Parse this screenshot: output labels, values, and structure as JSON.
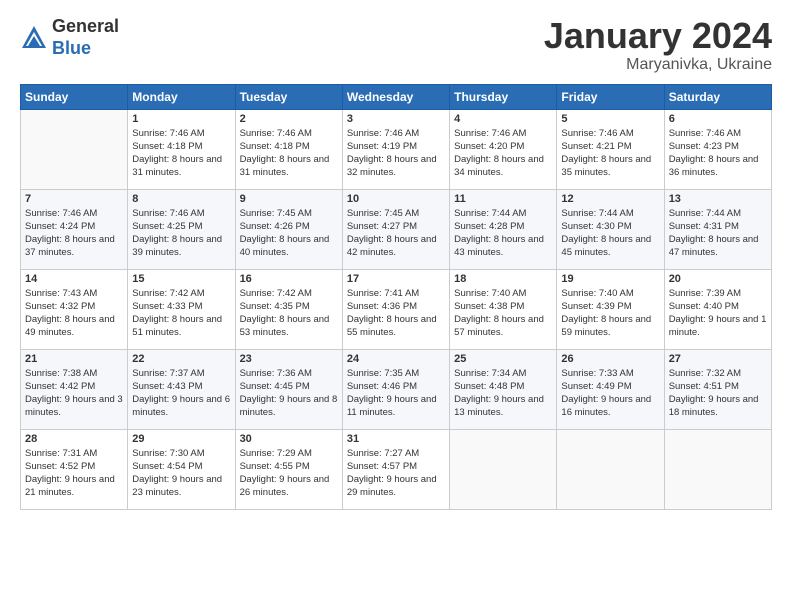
{
  "logo": {
    "general": "General",
    "blue": "Blue"
  },
  "header": {
    "month": "January 2024",
    "location": "Maryanivka, Ukraine"
  },
  "weekdays": [
    "Sunday",
    "Monday",
    "Tuesday",
    "Wednesday",
    "Thursday",
    "Friday",
    "Saturday"
  ],
  "weeks": [
    [
      {
        "day": "",
        "sunrise": "",
        "sunset": "",
        "daylight": ""
      },
      {
        "day": "1",
        "sunrise": "Sunrise: 7:46 AM",
        "sunset": "Sunset: 4:18 PM",
        "daylight": "Daylight: 8 hours and 31 minutes."
      },
      {
        "day": "2",
        "sunrise": "Sunrise: 7:46 AM",
        "sunset": "Sunset: 4:18 PM",
        "daylight": "Daylight: 8 hours and 31 minutes."
      },
      {
        "day": "3",
        "sunrise": "Sunrise: 7:46 AM",
        "sunset": "Sunset: 4:19 PM",
        "daylight": "Daylight: 8 hours and 32 minutes."
      },
      {
        "day": "4",
        "sunrise": "Sunrise: 7:46 AM",
        "sunset": "Sunset: 4:20 PM",
        "daylight": "Daylight: 8 hours and 34 minutes."
      },
      {
        "day": "5",
        "sunrise": "Sunrise: 7:46 AM",
        "sunset": "Sunset: 4:21 PM",
        "daylight": "Daylight: 8 hours and 35 minutes."
      },
      {
        "day": "6",
        "sunrise": "Sunrise: 7:46 AM",
        "sunset": "Sunset: 4:23 PM",
        "daylight": "Daylight: 8 hours and 36 minutes."
      }
    ],
    [
      {
        "day": "7",
        "sunrise": "Sunrise: 7:46 AM",
        "sunset": "Sunset: 4:24 PM",
        "daylight": "Daylight: 8 hours and 37 minutes."
      },
      {
        "day": "8",
        "sunrise": "Sunrise: 7:46 AM",
        "sunset": "Sunset: 4:25 PM",
        "daylight": "Daylight: 8 hours and 39 minutes."
      },
      {
        "day": "9",
        "sunrise": "Sunrise: 7:45 AM",
        "sunset": "Sunset: 4:26 PM",
        "daylight": "Daylight: 8 hours and 40 minutes."
      },
      {
        "day": "10",
        "sunrise": "Sunrise: 7:45 AM",
        "sunset": "Sunset: 4:27 PM",
        "daylight": "Daylight: 8 hours and 42 minutes."
      },
      {
        "day": "11",
        "sunrise": "Sunrise: 7:44 AM",
        "sunset": "Sunset: 4:28 PM",
        "daylight": "Daylight: 8 hours and 43 minutes."
      },
      {
        "day": "12",
        "sunrise": "Sunrise: 7:44 AM",
        "sunset": "Sunset: 4:30 PM",
        "daylight": "Daylight: 8 hours and 45 minutes."
      },
      {
        "day": "13",
        "sunrise": "Sunrise: 7:44 AM",
        "sunset": "Sunset: 4:31 PM",
        "daylight": "Daylight: 8 hours and 47 minutes."
      }
    ],
    [
      {
        "day": "14",
        "sunrise": "Sunrise: 7:43 AM",
        "sunset": "Sunset: 4:32 PM",
        "daylight": "Daylight: 8 hours and 49 minutes."
      },
      {
        "day": "15",
        "sunrise": "Sunrise: 7:42 AM",
        "sunset": "Sunset: 4:33 PM",
        "daylight": "Daylight: 8 hours and 51 minutes."
      },
      {
        "day": "16",
        "sunrise": "Sunrise: 7:42 AM",
        "sunset": "Sunset: 4:35 PM",
        "daylight": "Daylight: 8 hours and 53 minutes."
      },
      {
        "day": "17",
        "sunrise": "Sunrise: 7:41 AM",
        "sunset": "Sunset: 4:36 PM",
        "daylight": "Daylight: 8 hours and 55 minutes."
      },
      {
        "day": "18",
        "sunrise": "Sunrise: 7:40 AM",
        "sunset": "Sunset: 4:38 PM",
        "daylight": "Daylight: 8 hours and 57 minutes."
      },
      {
        "day": "19",
        "sunrise": "Sunrise: 7:40 AM",
        "sunset": "Sunset: 4:39 PM",
        "daylight": "Daylight: 8 hours and 59 minutes."
      },
      {
        "day": "20",
        "sunrise": "Sunrise: 7:39 AM",
        "sunset": "Sunset: 4:40 PM",
        "daylight": "Daylight: 9 hours and 1 minute."
      }
    ],
    [
      {
        "day": "21",
        "sunrise": "Sunrise: 7:38 AM",
        "sunset": "Sunset: 4:42 PM",
        "daylight": "Daylight: 9 hours and 3 minutes."
      },
      {
        "day": "22",
        "sunrise": "Sunrise: 7:37 AM",
        "sunset": "Sunset: 4:43 PM",
        "daylight": "Daylight: 9 hours and 6 minutes."
      },
      {
        "day": "23",
        "sunrise": "Sunrise: 7:36 AM",
        "sunset": "Sunset: 4:45 PM",
        "daylight": "Daylight: 9 hours and 8 minutes."
      },
      {
        "day": "24",
        "sunrise": "Sunrise: 7:35 AM",
        "sunset": "Sunset: 4:46 PM",
        "daylight": "Daylight: 9 hours and 11 minutes."
      },
      {
        "day": "25",
        "sunrise": "Sunrise: 7:34 AM",
        "sunset": "Sunset: 4:48 PM",
        "daylight": "Daylight: 9 hours and 13 minutes."
      },
      {
        "day": "26",
        "sunrise": "Sunrise: 7:33 AM",
        "sunset": "Sunset: 4:49 PM",
        "daylight": "Daylight: 9 hours and 16 minutes."
      },
      {
        "day": "27",
        "sunrise": "Sunrise: 7:32 AM",
        "sunset": "Sunset: 4:51 PM",
        "daylight": "Daylight: 9 hours and 18 minutes."
      }
    ],
    [
      {
        "day": "28",
        "sunrise": "Sunrise: 7:31 AM",
        "sunset": "Sunset: 4:52 PM",
        "daylight": "Daylight: 9 hours and 21 minutes."
      },
      {
        "day": "29",
        "sunrise": "Sunrise: 7:30 AM",
        "sunset": "Sunset: 4:54 PM",
        "daylight": "Daylight: 9 hours and 23 minutes."
      },
      {
        "day": "30",
        "sunrise": "Sunrise: 7:29 AM",
        "sunset": "Sunset: 4:55 PM",
        "daylight": "Daylight: 9 hours and 26 minutes."
      },
      {
        "day": "31",
        "sunrise": "Sunrise: 7:27 AM",
        "sunset": "Sunset: 4:57 PM",
        "daylight": "Daylight: 9 hours and 29 minutes."
      },
      {
        "day": "",
        "sunrise": "",
        "sunset": "",
        "daylight": ""
      },
      {
        "day": "",
        "sunrise": "",
        "sunset": "",
        "daylight": ""
      },
      {
        "day": "",
        "sunrise": "",
        "sunset": "",
        "daylight": ""
      }
    ]
  ]
}
